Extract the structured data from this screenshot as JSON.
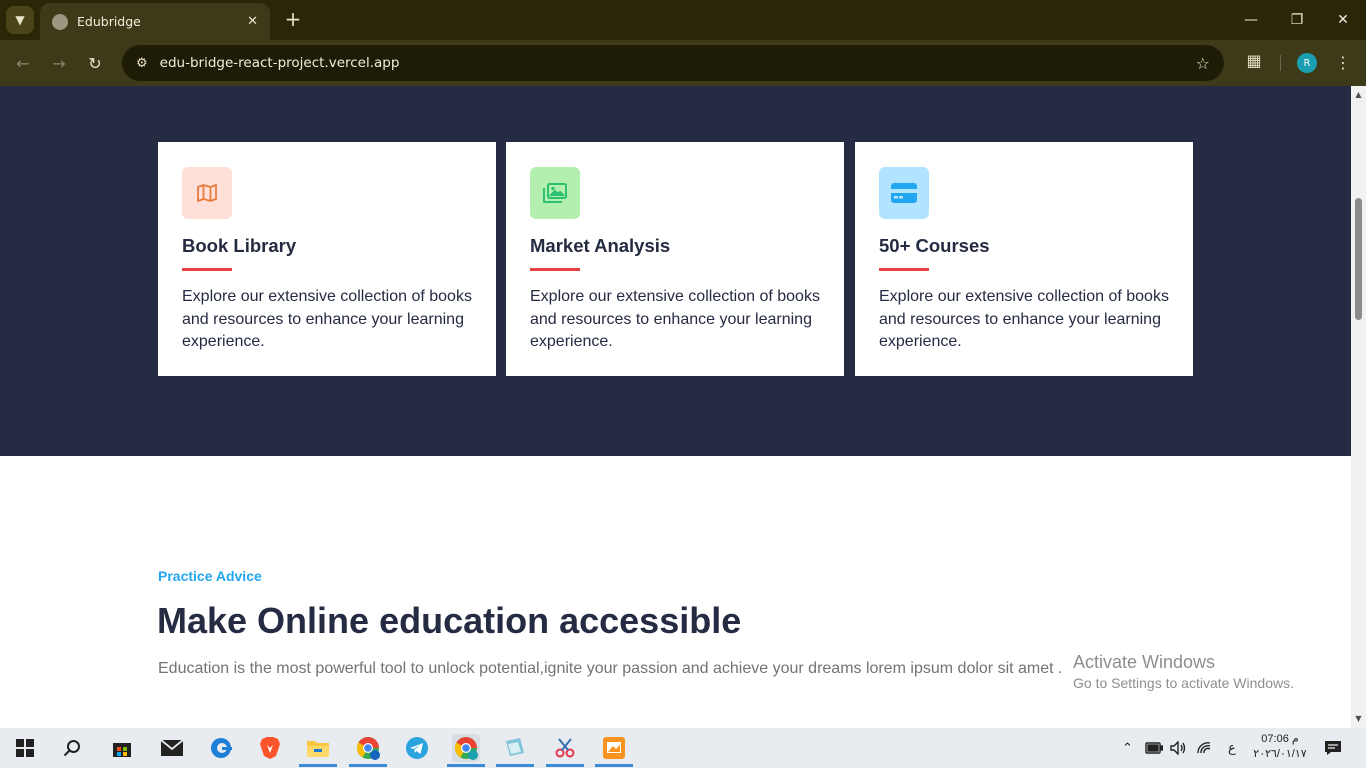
{
  "browser": {
    "tab_title": "Edubridge",
    "url": "edu-bridge-react-project.vercel.app",
    "profile_initial": "R"
  },
  "features": [
    {
      "title": "Book Library",
      "text": "Explore our extensive collection of books and resources to enhance your learning experience.",
      "icon": "map-icon",
      "icon_bg": "#ffe0d9",
      "icon_color": "#e77c40"
    },
    {
      "title": "Market Analysis",
      "text": "Explore our extensive collection of books and resources to enhance your learning experience.",
      "icon": "image-gallery-icon",
      "icon_bg": "#b3f0b0",
      "icon_color": "#2dc071"
    },
    {
      "title": "50+ Courses",
      "text": "Explore our extensive collection of books and resources to enhance your learning experience.",
      "icon": "credit-card-icon",
      "icon_bg": "#b2e3ff",
      "icon_color": "#23a6f0"
    }
  ],
  "practice": {
    "eyebrow": "Practice Advice",
    "headline": "Make Online education accessible",
    "subtext": "Education is the most powerful tool to unlock potential,ignite your passion and achieve your dreams lorem ipsum dolor sit amet ."
  },
  "watermark": {
    "line1": "Activate Windows",
    "line2": "Go to Settings to activate Windows."
  },
  "taskbar": {
    "time": "07:06 م",
    "date": "٢٠٢٦/٠١/١٧",
    "lang": "ع"
  },
  "colors": {
    "dark_band": "#252b42",
    "accent_line": "#e74040",
    "practice_blue": "#23a6f0"
  }
}
